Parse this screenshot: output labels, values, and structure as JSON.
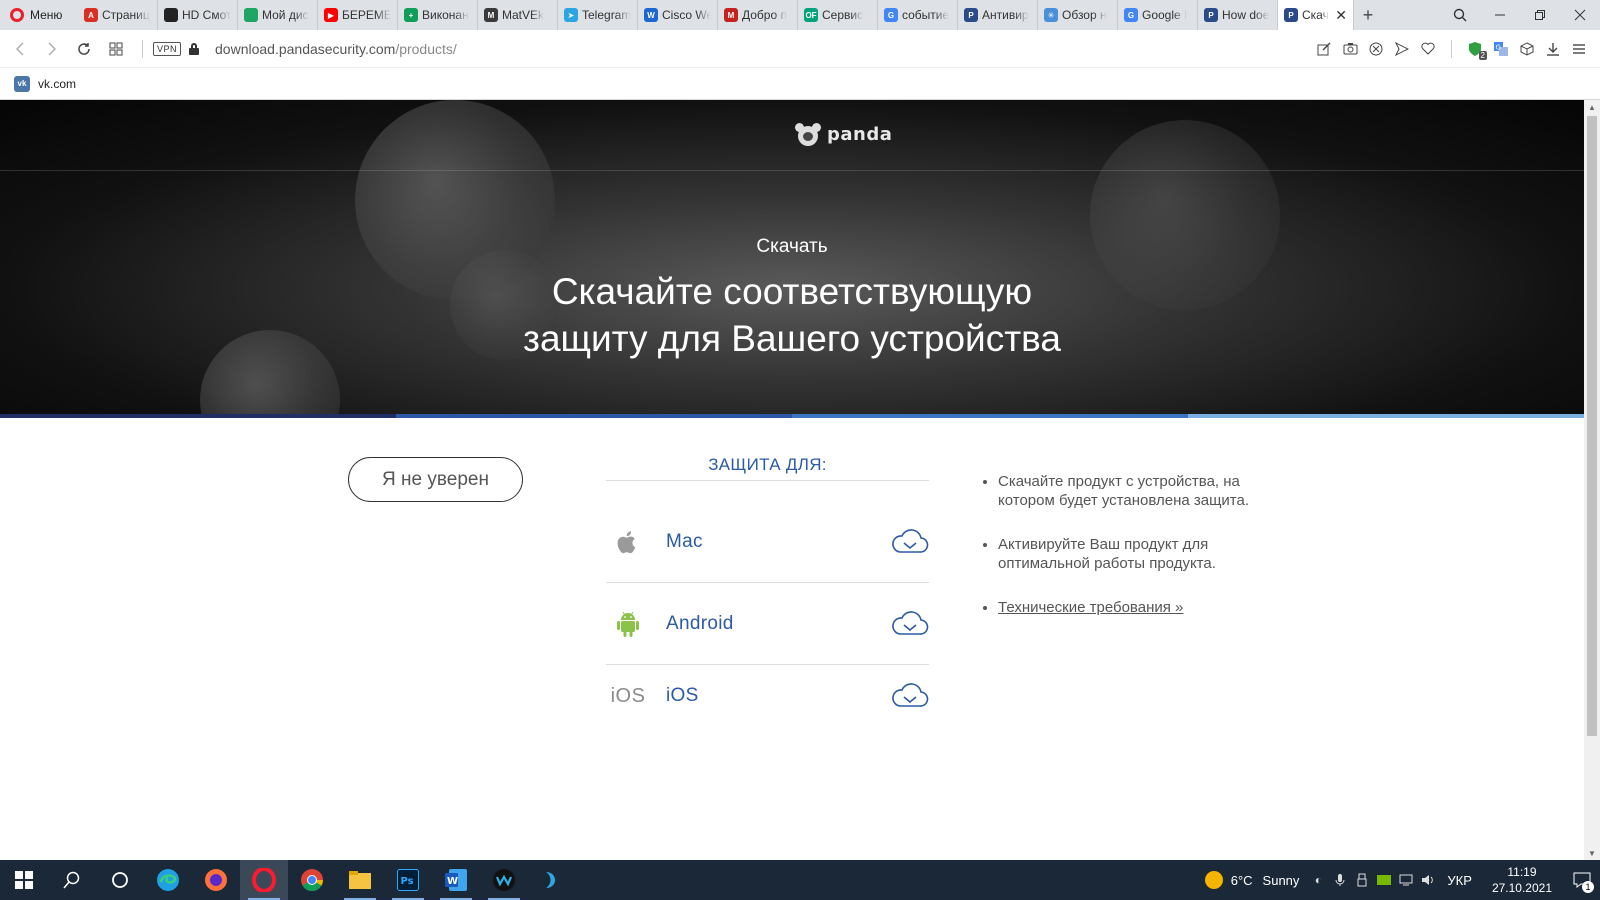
{
  "browser": {
    "menu_label": "Меню",
    "tabs": [
      {
        "title": "Страниц",
        "color": "#d93025",
        "glyph": "A"
      },
      {
        "title": "HD Смотрет",
        "color": "#222222",
        "glyph": ""
      },
      {
        "title": "Мой дис",
        "color": "#1fa463",
        "glyph": ""
      },
      {
        "title": "БЕРЕМЕН",
        "color": "#ff0000",
        "glyph": "▶"
      },
      {
        "title": "Виконан",
        "color": "#0f9d58",
        "glyph": "+"
      },
      {
        "title": "MatVEk",
        "color": "#3a3a3a",
        "glyph": "M"
      },
      {
        "title": "Telegram",
        "color": "#2ca5e0",
        "glyph": "➤"
      },
      {
        "title": "Cisco We",
        "color": "#1e66d0",
        "glyph": "W"
      },
      {
        "title": "Добро п",
        "color": "#c5221f",
        "glyph": "M"
      },
      {
        "title": "Сервис",
        "color": "#00a37a",
        "glyph": "OF"
      },
      {
        "title": "событие",
        "color": "#4285f4",
        "glyph": "G"
      },
      {
        "title": "Антивир",
        "color": "#2a4a8a",
        "glyph": "P"
      },
      {
        "title": "Обзор н",
        "color": "#4a90d9",
        "glyph": "✳"
      },
      {
        "title": "Google I",
        "color": "#4285f4",
        "glyph": "G"
      },
      {
        "title": "How doe",
        "color": "#2a4a8a",
        "glyph": "P"
      }
    ],
    "active_tab": {
      "title": "Скач",
      "color": "#2a4a8a",
      "glyph": "P"
    },
    "new_tab_icon": "+",
    "url_host": "download.pandasecurity.com",
    "url_path": "/products/",
    "vpn_label": "VPN",
    "bookmark": {
      "label": "vk.com",
      "glyph": "vk"
    }
  },
  "hero": {
    "logo_text": "panda",
    "kicker": "Скачать",
    "title_line1": "Скачайте соответствующую",
    "title_line2": "защиту для Вашего устройства"
  },
  "stripe_colors": [
    "#1f2f66",
    "#2b57a6",
    "#3a76c4",
    "#7aaee3"
  ],
  "main": {
    "unsure_button": "Я не уверен",
    "protection_heading": "ЗАЩИТА ДЛЯ:",
    "platforms": [
      {
        "name": "Mac",
        "icon": "apple-icon"
      },
      {
        "name": "Android",
        "icon": "android-icon"
      },
      {
        "name": "iOS",
        "icon": "ios-icon",
        "icon_text": "iOS"
      }
    ],
    "bullets": [
      "Скачайте продукт с устройства, на котором будет установлена защита.",
      "Активируйте Ваш продукт для оптимальной работы продукта."
    ],
    "tech_link": "Технические требования »"
  },
  "taskbar": {
    "weather_temp": "6°C",
    "weather_text": "Sunny",
    "language": "УКР",
    "time": "11:19",
    "date": "27.10.2021",
    "notification_count": "1",
    "badge_count": "2"
  },
  "colors": {
    "brand_blue": "#2b5aa6",
    "android_green": "#8bc34a"
  }
}
